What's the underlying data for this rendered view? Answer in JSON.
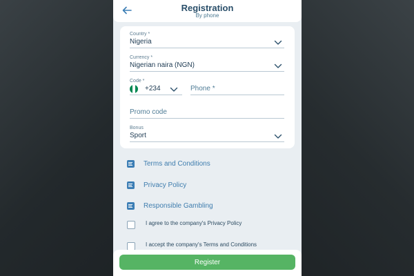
{
  "header": {
    "title": "Registration",
    "subtitle": "By phone"
  },
  "form": {
    "country": {
      "label": "Country *",
      "value": "Nigeria"
    },
    "currency": {
      "label": "Currency *",
      "value": "Nigerian naira (NGN)"
    },
    "code": {
      "label": "Code *",
      "value": "+234",
      "flag_colors": [
        "#008751",
        "#ffffff",
        "#008751"
      ]
    },
    "phone": {
      "placeholder": "Phone *"
    },
    "promo": {
      "placeholder": "Promo code"
    },
    "bonus": {
      "label": "Bonus",
      "value": "Sport"
    }
  },
  "documents": [
    {
      "label": "Terms and Conditions",
      "icon": "document-icon"
    },
    {
      "label": "Privacy Policy",
      "icon": "document-icon"
    },
    {
      "label": "Responsible Gambling",
      "icon": "document-icon"
    }
  ],
  "agreements": [
    {
      "label": "I agree to the company's Privacy Policy",
      "checked": false
    },
    {
      "label": "I accept the company's Terms and Conditions",
      "checked": false
    }
  ],
  "footer": {
    "register_label": "Register"
  },
  "colors": {
    "accent": "#3f7dae",
    "register_button": "#56b464",
    "title": "#2a4f6a"
  }
}
